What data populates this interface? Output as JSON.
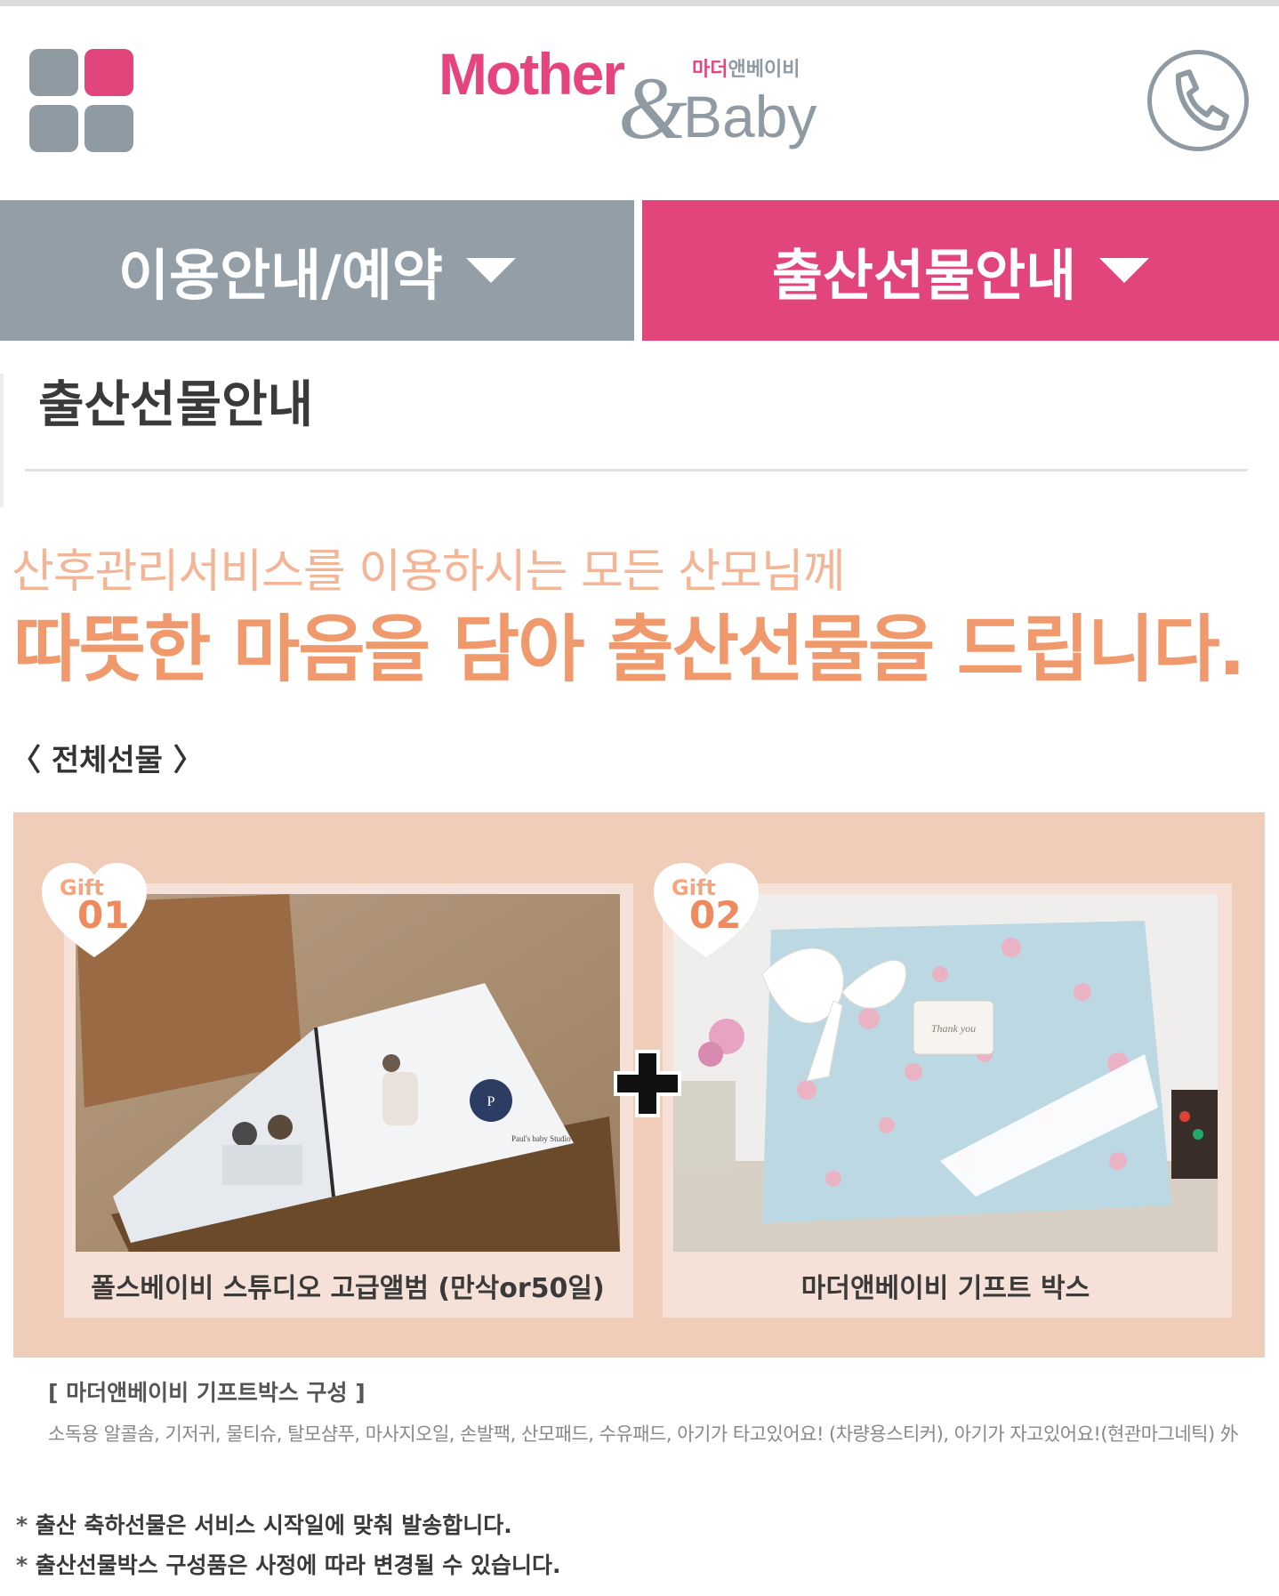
{
  "header": {
    "logo": {
      "mother": "Mother",
      "amp": "&",
      "baby": "Baby",
      "korean_pink": "마더",
      "korean_gray": "앤베이비"
    },
    "menu_icon": "grid-menu-icon",
    "phone_icon": "phone-icon"
  },
  "tabs": [
    {
      "label": "이용안내/예약",
      "active": false,
      "color": "#939ea7"
    },
    {
      "label": "출산선물안내",
      "active": true,
      "color": "#e1457c"
    }
  ],
  "page_title": "출산선물안내",
  "intro": {
    "subtitle": "산후관리서비스를 이용하시는 모든 산모님께",
    "headline": "따뜻한 마음을 담아 출산선물을 드립니다."
  },
  "section_label": "〈 전체선물 〉",
  "gifts": [
    {
      "badge_label": "Gift",
      "badge_number": "01",
      "caption": "폴스베이비 스튜디오 고급앨범 (만삭or50일)",
      "photo_text": "Paul's baby Studio"
    },
    {
      "badge_label": "Gift",
      "badge_number": "02",
      "caption": "마더앤베이비 기프트 박스",
      "photo_text": "Thank you"
    }
  ],
  "composition": {
    "title": "[ 마더앤베이비 기프트박스  구성 ]",
    "items": "소독용 알콜솜, 기저귀, 물티슈, 탈모샴푸, 마사지오일, 손발팩, 산모패드, 수유패드, 아기가 타고있어요! (차량용스티커), 아기가 자고있어요!(현관마그네틱) 外"
  },
  "notes": [
    "출산 축하선물은 서비스 시작일에 맞춰 발송합니다.",
    "출산선물박스 구성품은 사정에 따라 변경될 수 있습니다."
  ],
  "colors": {
    "pink": "#e1457c",
    "gray": "#939ea7",
    "peach": "#f0996d",
    "panel": "#f0cdb9"
  }
}
